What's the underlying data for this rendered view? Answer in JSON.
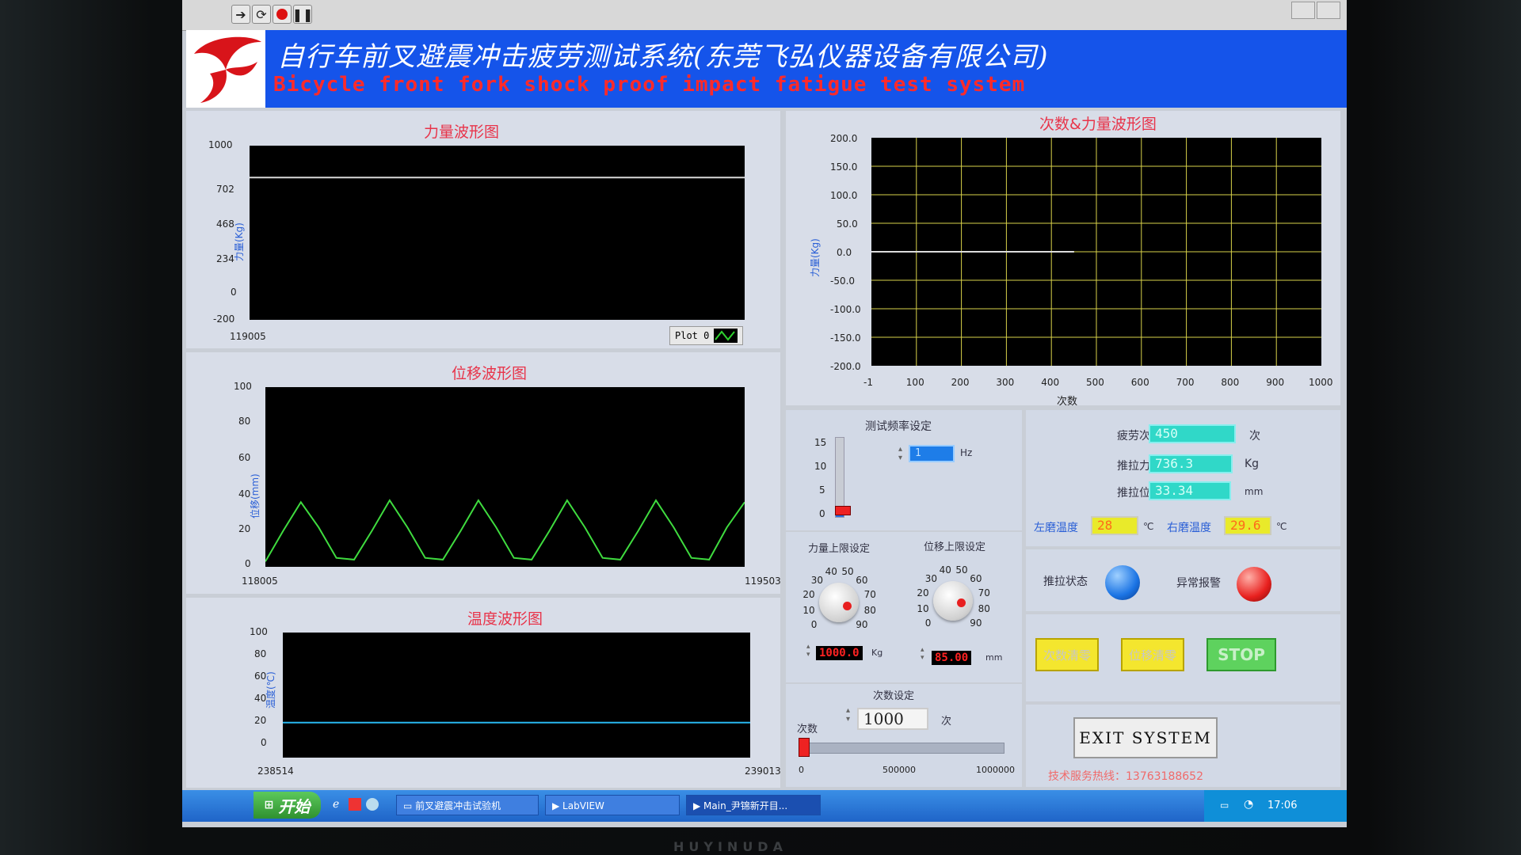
{
  "toolbar": {
    "icons": [
      "run-arrow-icon",
      "run-continuous-icon",
      "abort-icon",
      "pause-icon"
    ]
  },
  "banner": {
    "title_cn": "自行车前叉避震冲击疲劳测试系统(东莞飞弘仪器设备有限公司)",
    "title_en": "Bicycle front fork shock proof impact fatigue test system"
  },
  "force_chart": {
    "title": "力量波形图",
    "ylabel": "力量(Kg)",
    "yticks": [
      "1000",
      "702",
      "468",
      "234",
      "0",
      "-200"
    ],
    "xstart": "119005",
    "legend": "Plot 0",
    "chart_data": {
      "type": "line",
      "title": "力量波形图",
      "ylabel": "力量(Kg)",
      "ylim": [
        -200,
        1000
      ],
      "series": [
        {
          "values": [
            780,
            780
          ]
        }
      ]
    }
  },
  "disp_chart": {
    "title": "位移波形图",
    "ylabel": "位移(mm)",
    "yticks": [
      "100",
      "80",
      "60",
      "40",
      "20",
      "0"
    ],
    "xstart": "118005",
    "xend": "119503",
    "chart_data": {
      "type": "line",
      "title": "位移波形图",
      "ylabel": "位移(mm)",
      "ylim": [
        0,
        100
      ],
      "series": [
        {
          "values": [
            3,
            20,
            36,
            22,
            5,
            4,
            20,
            37,
            22,
            5,
            4,
            20,
            37,
            22,
            5,
            4,
            20,
            37,
            22,
            5,
            4,
            20,
            37,
            22,
            5,
            4,
            22,
            36
          ]
        }
      ]
    }
  },
  "temp_chart": {
    "title": "温度波形图",
    "ylabel": "温度(℃)",
    "yticks": [
      "100",
      "80",
      "60",
      "40",
      "20",
      "0"
    ],
    "xstart": "238514",
    "xend": "239013",
    "chart_data": {
      "type": "line",
      "title": "温度波形图",
      "ylabel": "温度(℃)",
      "ylim": [
        0,
        100
      ],
      "series": [
        {
          "values": [
            28,
            28
          ]
        }
      ]
    }
  },
  "count_chart": {
    "title": "次数&力量波形图",
    "ylabel": "力量(Kg)",
    "xlabel": "次数",
    "yticks": [
      "200.0",
      "150.0",
      "100.0",
      "50.0",
      "0.0",
      "-50.0",
      "-100.0",
      "-150.0",
      "-200.0"
    ],
    "xticks": [
      "-1",
      "100",
      "200",
      "300",
      "400",
      "500",
      "600",
      "700",
      "800",
      "900",
      "1000"
    ],
    "chart_data": {
      "type": "line",
      "title": "次数&力量波形图",
      "xlabel": "次数",
      "ylabel": "力量(Kg)",
      "xlim": [
        -1,
        1000
      ],
      "ylim": [
        -200,
        200
      ],
      "grid": true,
      "series": [
        {
          "x": [
            -1,
            450
          ],
          "values": [
            0,
            0
          ]
        }
      ]
    }
  },
  "freq": {
    "label": "测试频率设定",
    "value": "1",
    "unit": "Hz",
    "scale": [
      "15",
      "10",
      "5",
      "0"
    ],
    "level_fraction": 0.067
  },
  "force_limit": {
    "label": "力量上限设定",
    "value": "1000.0",
    "unit": "Kg",
    "ticks": [
      "0",
      "10",
      "20",
      "30",
      "40",
      "50",
      "60",
      "70",
      "80",
      "90"
    ]
  },
  "disp_limit": {
    "label": "位移上限设定",
    "value": "85.00",
    "unit": "mm",
    "ticks": [
      "0",
      "10",
      "20",
      "30",
      "40",
      "50",
      "60",
      "70",
      "80",
      "90"
    ]
  },
  "count_set": {
    "label": "次数设定",
    "prefix": "次数",
    "value": "1000",
    "unit": "次",
    "scale": [
      "0",
      "500000",
      "1000000"
    ],
    "level_fraction": 0.001
  },
  "readouts": {
    "fatigue_label": "疲劳次数",
    "fatigue_value": "450",
    "fatigue_unit": "次",
    "force_label": "推拉力值",
    "force_value": "736.3",
    "force_unit": "Kg",
    "disp_label": "推拉位移",
    "disp_value": "33.34",
    "disp_unit": "mm",
    "left_temp_label": "左磨温度",
    "left_temp_value": "28",
    "left_temp_unit": "℃",
    "right_temp_label": "右磨温度",
    "right_temp_value": "29.6",
    "right_temp_unit": "℃"
  },
  "status": {
    "pull_label": "推拉状态",
    "alarm_label": "异常报警",
    "pull_color": "#1b74e4",
    "alarm_color": "#e8201e"
  },
  "buttons": {
    "count_reset": "次数清零",
    "disp_reset": "位移清零",
    "stop": "STOP",
    "exit": "EXIT SYSTEM"
  },
  "hotline": "技术服务热线：13763188652",
  "taskbar": {
    "start": "开始",
    "task1": "前叉避震冲击试验机",
    "task2": "LabVIEW",
    "task3": "Main_尹锦新开目...",
    "clock": "17:06"
  },
  "bezel": "HUYINUDA"
}
